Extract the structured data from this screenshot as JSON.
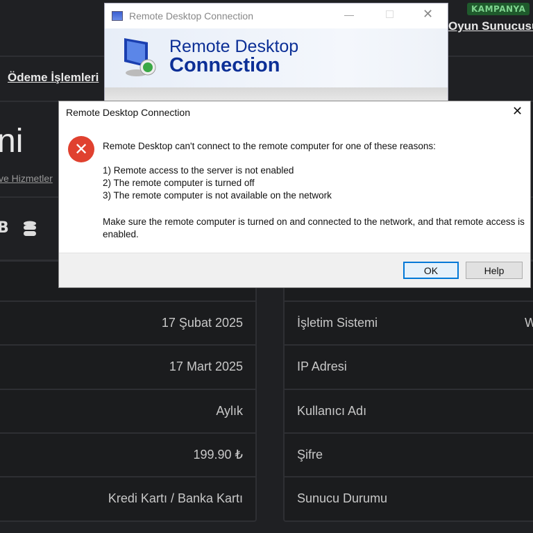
{
  "header": {
    "badge": "KAMPANYA",
    "top_link": "Oyun Sunucusu",
    "nav_link": "Ödeme İşlemleri"
  },
  "page": {
    "title_fragment": "ni",
    "sub_link": "ve Hizmetler",
    "icon_row_text": "B"
  },
  "left_panel": {
    "rows": [
      {
        "value": "17 Şubat 2025"
      },
      {
        "value": "17 Mart 2025"
      },
      {
        "value": "Aylık"
      },
      {
        "value": "199.90 ₺"
      },
      {
        "value": "Kredi Kartı / Banka Kartı"
      }
    ]
  },
  "right_panel": {
    "rows": [
      {
        "label": "İşletim Sistemi",
        "value": "W"
      },
      {
        "label": "IP Adresi"
      },
      {
        "label": "Kullanıcı Adı"
      },
      {
        "label": "Şifre"
      },
      {
        "label": "Sunucu Durumu"
      }
    ]
  },
  "rdc_window": {
    "title": "Remote Desktop Connection",
    "banner_line1": "Remote Desktop",
    "banner_line2": "Connection"
  },
  "dialog": {
    "title": "Remote Desktop Connection",
    "intro": "Remote Desktop can't connect to the remote computer for one of these reasons:",
    "reasons": [
      "1) Remote access to the server is not enabled",
      "2) The remote computer is turned off",
      "3) The remote computer is not available on the network"
    ],
    "advice": "Make sure the remote computer is turned on and connected to the network, and that remote access is enabled.",
    "ok_label": "OK",
    "help_label": "Help"
  },
  "colors": {
    "page_bg": "#1f2023",
    "badge_bg": "#1f5a2c",
    "error_red": "#e0412f",
    "dialog_title_accent": "#0c2f96"
  }
}
